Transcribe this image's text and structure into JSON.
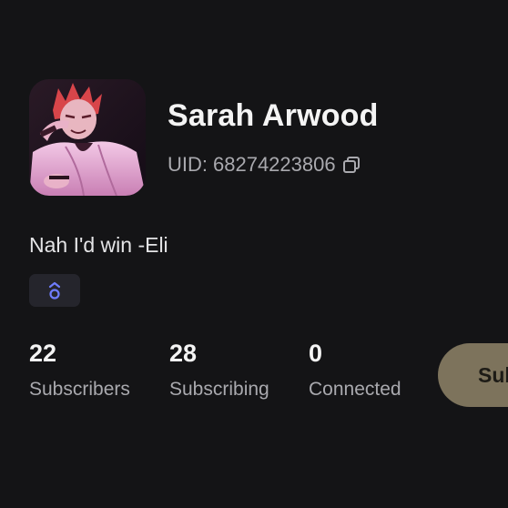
{
  "header": {
    "back_icon": "chevron-left-icon"
  },
  "profile": {
    "name": "Sarah Arwood",
    "uid_label": "UID:",
    "uid_value": "68274223806",
    "copy_icon": "copy-icon",
    "avatar": "anime-character-avatar",
    "bio": "Nah I'd win -Eli",
    "badge_icon": "level-badge-icon"
  },
  "stats": [
    {
      "count": "22",
      "label": "Subscribers"
    },
    {
      "count": "28",
      "label": "Subscribing"
    },
    {
      "count": "0",
      "label": "Connected"
    }
  ],
  "actions": {
    "subscribe_label": "Subscribe"
  },
  "colors": {
    "background": "#141416",
    "subscribe_button": "#7d735c",
    "badge_accent": "#6f7dff"
  }
}
